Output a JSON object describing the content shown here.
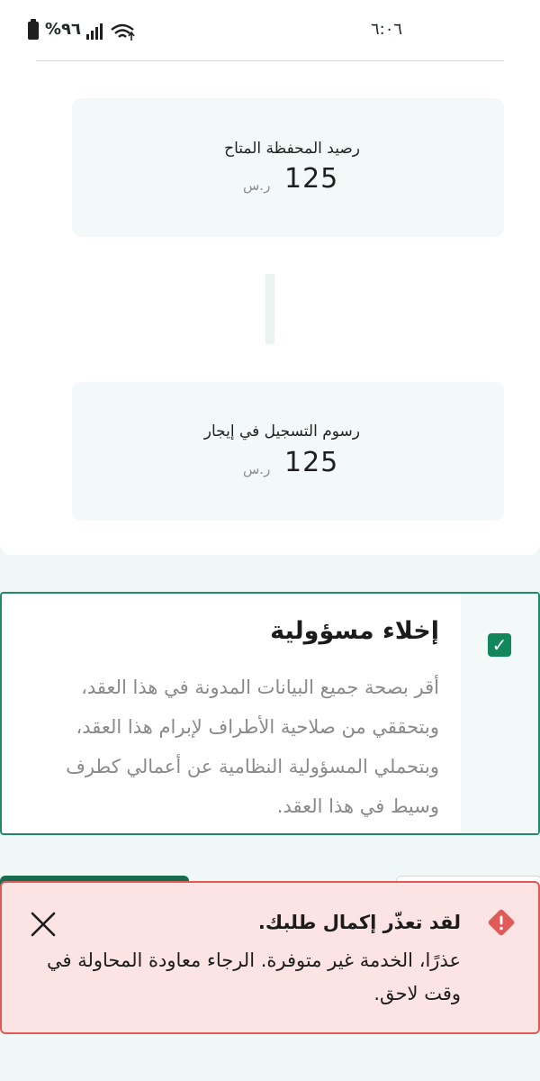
{
  "status_bar": {
    "time": "٦:٠٦",
    "battery": "%٩٦"
  },
  "fees": [
    {
      "label": "رصيد المحفظة المتاح",
      "amount": "125",
      "currency": "ر.س"
    },
    {
      "label": "رسوم التسجيل في إيجار",
      "amount": "125",
      "currency": "ر.س"
    }
  ],
  "disclaimer": {
    "checked": true,
    "title": "إخلاء مسؤولية",
    "text": "أقر بصحة جميع البيانات المدونة في هذا العقد، وبتحققي من صلاحية الأطراف لإبرام هذا العقد، وبتحملي المسؤولية النظامية عن أعمالي كطرف وسيط في هذا العقد."
  },
  "toast": {
    "title": "لقد تعذّر إكمال طلبك.",
    "message": "عذرًا، الخدمة غير متوفرة. الرجاء معاودة المحاولة في وقت لاحق."
  },
  "colors": {
    "accent": "#12875c",
    "error": "#e05a58",
    "error_bg": "#fde4e4"
  }
}
